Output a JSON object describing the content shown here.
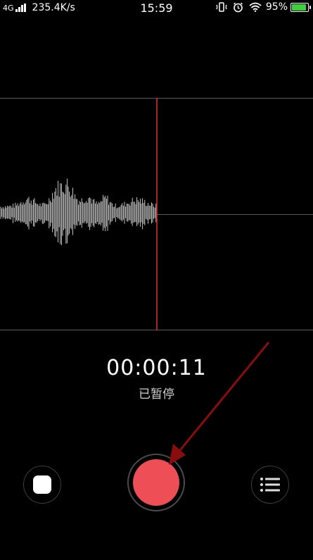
{
  "status_bar": {
    "network_type": "4G",
    "net_speed": "235.4K/s",
    "time": "15:59",
    "battery_percent": "95%",
    "battery_color": "#3ad13a",
    "icons": [
      "signal-icon",
      "vibrate-icon",
      "alarm-icon",
      "wifi-icon",
      "battery-icon"
    ]
  },
  "recorder": {
    "elapsed_time": "00:00:11",
    "state_label": "已暂停",
    "record_color": "#ee4e55",
    "playhead_color": "#e0302f"
  },
  "controls": {
    "stop_icon": "stop-icon",
    "record_icon": "record-icon",
    "list_icon": "list-icon"
  },
  "annotation": {
    "arrow_color": "#8a0d0d"
  }
}
